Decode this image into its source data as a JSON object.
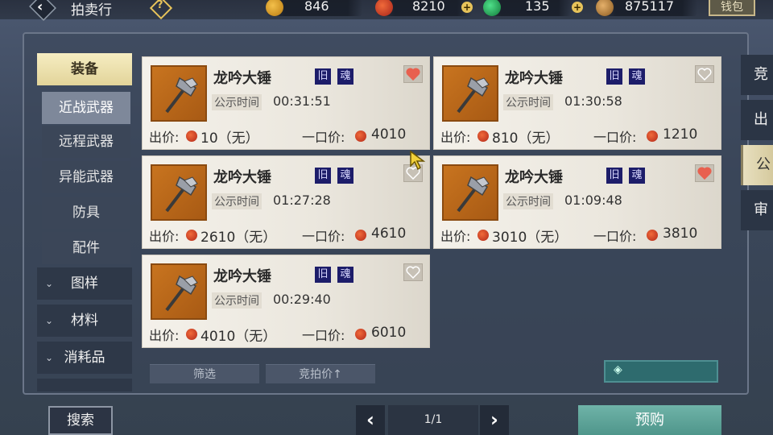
{
  "header": {
    "title": "拍卖行",
    "help_symbol": "?",
    "currencies": [
      {
        "icon": "gold-pouch-icon",
        "value": "846"
      },
      {
        "icon": "red-spiral-coin-icon",
        "value": "8210"
      },
      {
        "icon": "jade-icon",
        "value": "135"
      },
      {
        "icon": "silver-pouch-icon",
        "value": "875117"
      }
    ],
    "wallet_label": "钱包"
  },
  "sidebar": {
    "categories": [
      {
        "label": "装备",
        "active": true
      },
      {
        "label": "图样",
        "active": false
      },
      {
        "label": "材料",
        "active": false
      },
      {
        "label": "消耗品",
        "active": false
      }
    ],
    "subitems": [
      {
        "label": "近战武器",
        "active": true
      },
      {
        "label": "远程武器",
        "active": false
      },
      {
        "label": "异能武器",
        "active": false
      },
      {
        "label": "防具",
        "active": false
      },
      {
        "label": "配件",
        "active": false
      }
    ]
  },
  "listings": [
    {
      "name": "龙吟大锤",
      "tag1": "旧",
      "tag2": "魂",
      "time_label": "公示时间",
      "time": "00:31:51",
      "bid_label": "出价:",
      "bid": "10（无）",
      "buyout_label": "一口价:",
      "buyout": "4010",
      "favorited": true
    },
    {
      "name": "龙吟大锤",
      "tag1": "旧",
      "tag2": "魂",
      "time_label": "公示时间",
      "time": "01:30:58",
      "bid_label": "出价:",
      "bid": "810（无）",
      "buyout_label": "一口价:",
      "buyout": "1210",
      "favorited": false
    },
    {
      "name": "龙吟大锤",
      "tag1": "旧",
      "tag2": "魂",
      "time_label": "公示时间",
      "time": "01:27:28",
      "bid_label": "出价:",
      "bid": "2610（无）",
      "buyout_label": "一口价:",
      "buyout": "4610",
      "favorited": false
    },
    {
      "name": "龙吟大锤",
      "tag1": "旧",
      "tag2": "魂",
      "time_label": "公示时间",
      "time": "01:09:48",
      "bid_label": "出价:",
      "bid": "3010（无）",
      "buyout_label": "一口价:",
      "buyout": "3810",
      "favorited": true
    },
    {
      "name": "龙吟大锤",
      "tag1": "旧",
      "tag2": "魂",
      "time_label": "公示时间",
      "time": "00:29:40",
      "bid_label": "出价:",
      "bid": "4010（无）",
      "buyout_label": "一口价:",
      "buyout": "6010",
      "favorited": false
    }
  ],
  "filters": {
    "filter_label": "筛选",
    "sort_label": "竞拍价↑"
  },
  "right_tabs": [
    {
      "label": "竞拍",
      "active": false
    },
    {
      "label": "出售",
      "active": false
    },
    {
      "label": "公示",
      "active": true
    },
    {
      "label": "审核",
      "active": false
    }
  ],
  "footer": {
    "search_label": "搜索",
    "prev_symbol": "‹",
    "next_symbol": "›",
    "page": "1/1",
    "preorder_label": "预购"
  },
  "colors": {
    "accent_gold": "#e7c35a",
    "active_category": "#e2d49a",
    "teal_button": "#4f968b",
    "heart_red": "#e8604f"
  }
}
